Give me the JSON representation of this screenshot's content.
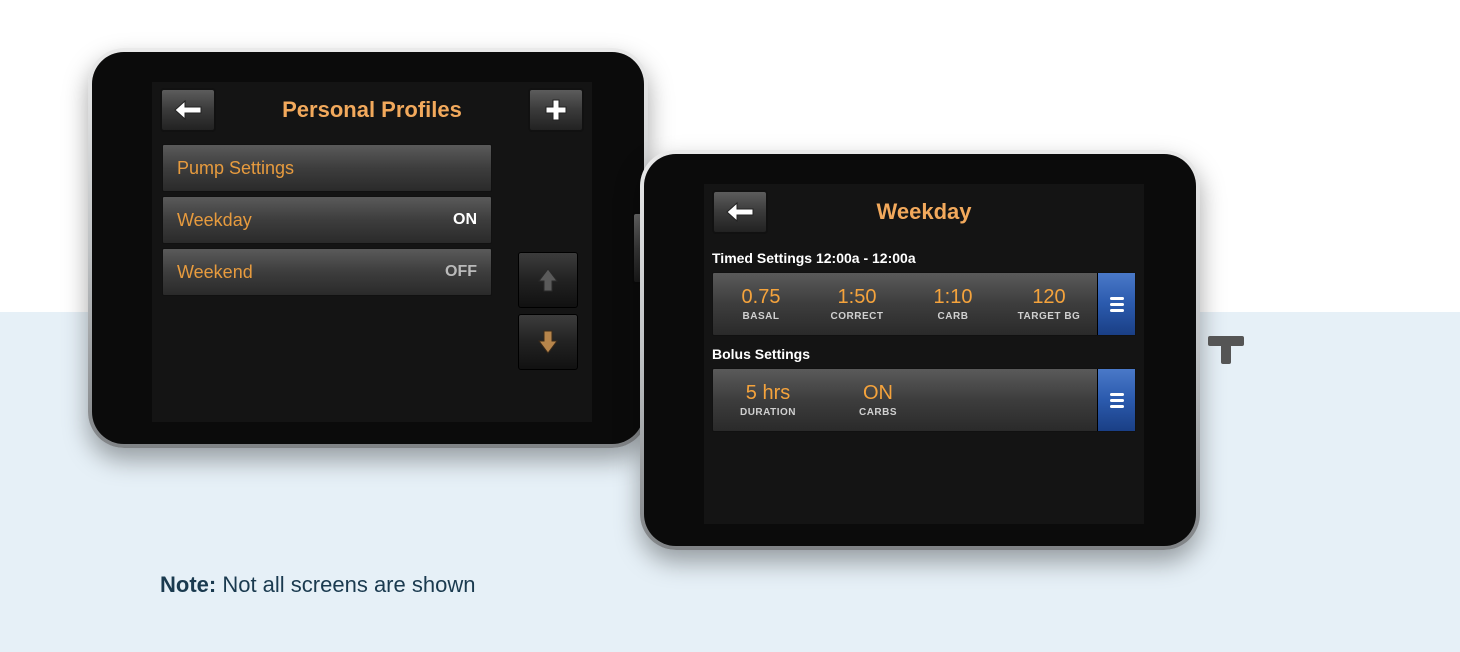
{
  "note": {
    "label": "Note:",
    "text": " Not all screens are shown"
  },
  "device1": {
    "header": {
      "title": "Personal Profiles"
    },
    "rows": [
      {
        "label": "Pump Settings",
        "status": ""
      },
      {
        "label": "Weekday",
        "status": "ON"
      },
      {
        "label": "Weekend",
        "status": "OFF"
      }
    ]
  },
  "device2": {
    "header": {
      "title": "Weekday"
    },
    "timed_label": "Timed Settings 12:00a - 12:00a",
    "timed": [
      {
        "value": "0.75",
        "label": "BASAL"
      },
      {
        "value": "1:50",
        "label": "CORRECT"
      },
      {
        "value": "1:10",
        "label": "CARB"
      },
      {
        "value": "120",
        "label": "TARGET BG"
      }
    ],
    "bolus_label": "Bolus Settings",
    "bolus": [
      {
        "value": "5 hrs",
        "label": "DURATION"
      },
      {
        "value": "ON",
        "label": "CARBS"
      }
    ]
  }
}
